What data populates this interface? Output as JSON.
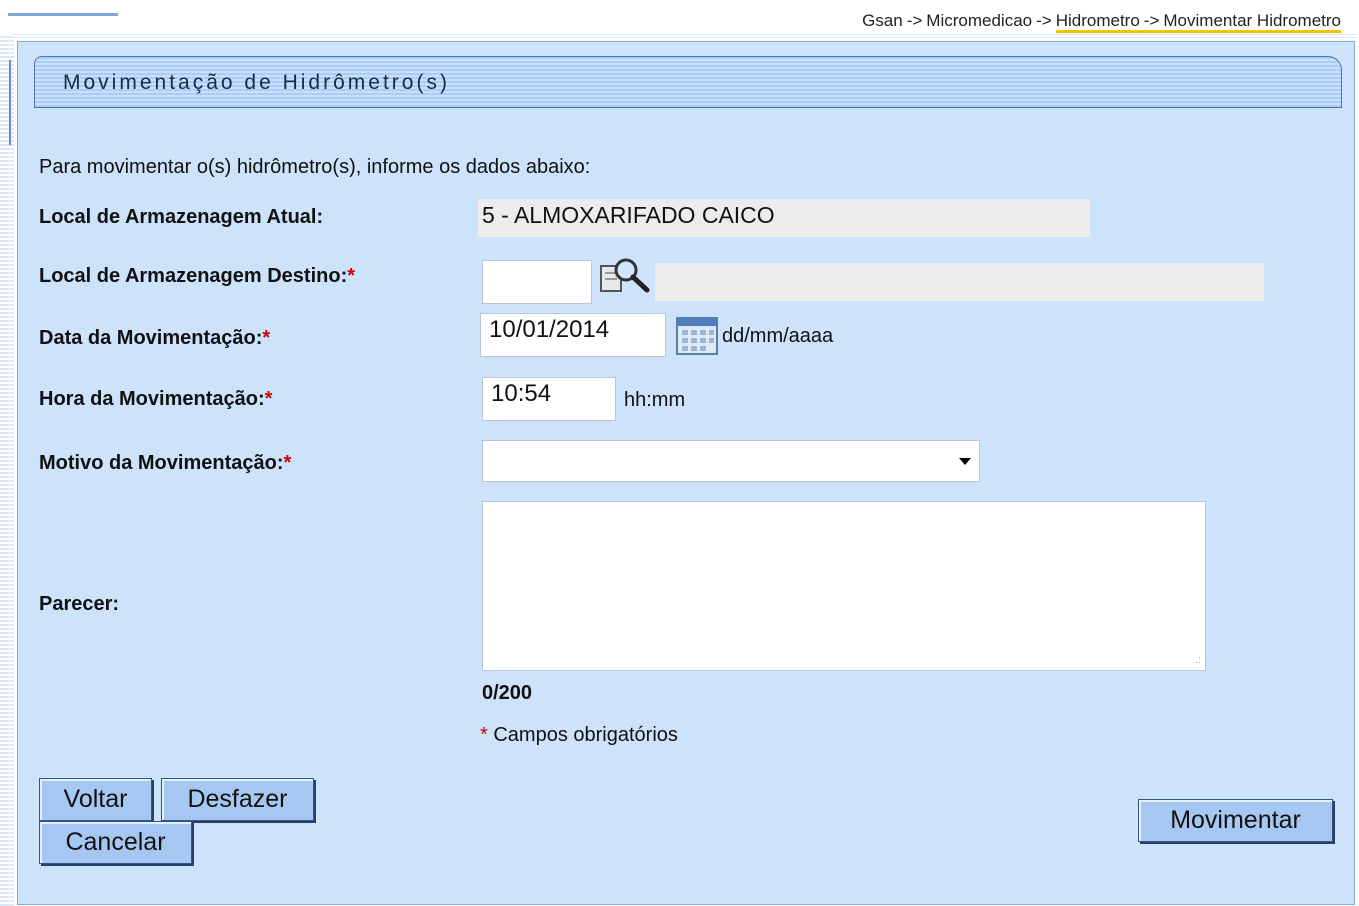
{
  "breadcrumb": {
    "items": [
      "Gsan",
      "Micromedicao",
      "Hidrometro",
      "Movimentar Hidrometro"
    ],
    "separator": "->"
  },
  "panel": {
    "title": "Movimentação de Hidrômetro(s)"
  },
  "form": {
    "intro": "Para movimentar o(s) hidrômetro(s), informe os dados abaixo:",
    "required_mark": "*",
    "local_atual": {
      "label": "Local de Armazenagem Atual:",
      "value": "5 - ALMOXARIFADO CAICO"
    },
    "local_destino": {
      "label": "Local de Armazenagem Destino:",
      "code": "",
      "description": ""
    },
    "data": {
      "label": "Data da Movimentação:",
      "value": "10/01/2014",
      "hint": "dd/mm/aaaa"
    },
    "hora": {
      "label": "Hora da Movimentação:",
      "value": "10:54",
      "hint": "hh:mm"
    },
    "motivo": {
      "label": "Motivo da Movimentação:",
      "selected": ""
    },
    "parecer": {
      "label": "Parecer:",
      "value": "",
      "counter": "0/200"
    },
    "required_note": "Campos obrigatórios"
  },
  "buttons": {
    "voltar": "Voltar",
    "desfazer": "Desfazer",
    "cancelar": "Cancelar",
    "movimentar": "Movimentar"
  },
  "icons": {
    "search": "magnifier-icon",
    "calendar": "calendar-icon"
  },
  "colors": {
    "panel_bg": "#cde3fb",
    "button_bg": "#a6c7f1",
    "required": "#d00000",
    "breadcrumb_underline": "#f7c300"
  }
}
